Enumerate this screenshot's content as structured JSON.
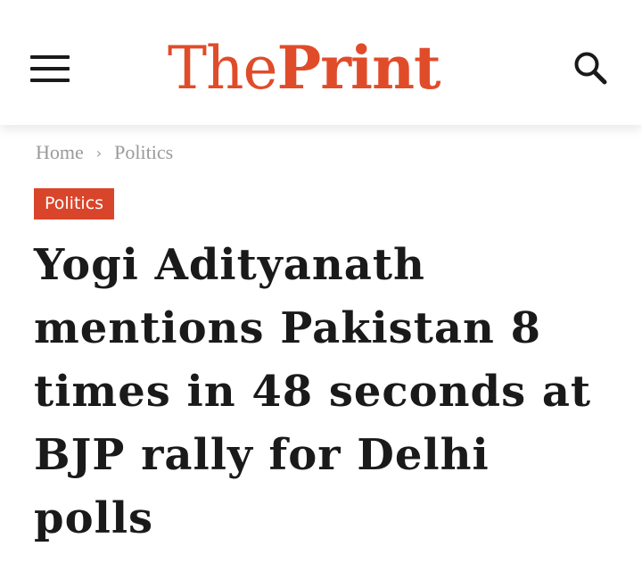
{
  "header": {
    "logo_part1": "The",
    "logo_part2": "Print",
    "menu_icon": "hamburger-menu-icon",
    "search_icon": "search-icon"
  },
  "breadcrumb": {
    "home": "Home",
    "separator": "›",
    "current": "Politics"
  },
  "article": {
    "category": "Politics",
    "headline": "Yogi Adityanath mentions Pakistan 8 times in 48 seconds at BJP rally for Delhi polls"
  },
  "colors": {
    "brand": "#e04c2a",
    "badge": "#d9452a",
    "text": "#1a1a1a",
    "muted": "#9a9a9a"
  }
}
